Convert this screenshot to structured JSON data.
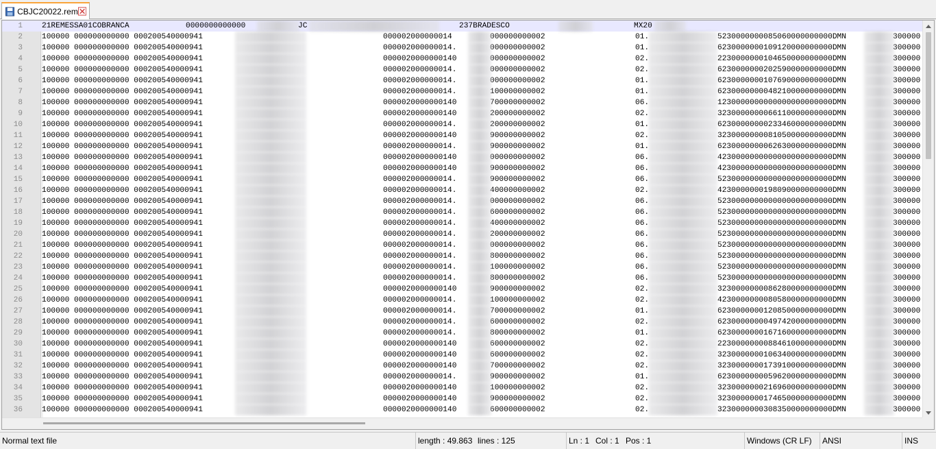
{
  "tab": {
    "filename": "CBJC20022.rem",
    "save_icon": "floppy-disk-icon",
    "close_icon": "close-x-icon"
  },
  "editor": {
    "header_line": {
      "number": "1",
      "part1": "21REMESSA01COBRANCA",
      "part2": "0000000000000",
      "part3": "JC",
      "part4": "237BRADESCO",
      "part5": "MX20"
    },
    "lines": [
      {
        "n": "2",
        "c": "000002000000014",
        "d": "000000000002",
        "e": "01.",
        "f": "5230000000085060000000000DMN",
        "g": "300000"
      },
      {
        "n": "3",
        "c": "000002000000014.",
        "d": "000000000002",
        "e": "01.",
        "f": "6230000000109120000000000DMN",
        "g": "300000"
      },
      {
        "n": "4",
        "c": "0000020000000140",
        "d": "000000000002",
        "e": "02.",
        "f": "2230000000104650000000000DMN",
        "g": "300000"
      },
      {
        "n": "5",
        "c": "000002000000014.",
        "d": "000000000002",
        "e": "02.",
        "f": "6230000000202590000000000DMN",
        "g": "300000"
      },
      {
        "n": "6",
        "c": "000002000000014.",
        "d": "000000000002",
        "e": "01.",
        "f": "6230000000107690000000000DMN",
        "g": "300000"
      },
      {
        "n": "7",
        "c": "000002000000014.",
        "d": "100000000002",
        "e": "01.",
        "f": "6230000000048210000000000DMN",
        "g": "300000"
      },
      {
        "n": "8",
        "c": "0000020000000140",
        "d": "700000000002",
        "e": "06.",
        "f": "1230000000000000000000000DMN",
        "g": "300000"
      },
      {
        "n": "9",
        "c": "0000020000000140",
        "d": "200000000002",
        "e": "02.",
        "f": "3230000000066110000000000DMN",
        "g": "300000"
      },
      {
        "n": "10",
        "c": "000002000000014.",
        "d": "200000000002",
        "e": "01.",
        "f": "6230000000023346000000000DMN",
        "g": "300000"
      },
      {
        "n": "11",
        "c": "0000020000000140",
        "d": "900000000002",
        "e": "02.",
        "f": "3230000000081050000000000DMN",
        "g": "300000"
      },
      {
        "n": "12",
        "c": "000002000000014.",
        "d": "900000000002",
        "e": "01.",
        "f": "6230000000062630000000000DMN",
        "g": "300000"
      },
      {
        "n": "13",
        "c": "0000020000000140",
        "d": "000000000002",
        "e": "06.",
        "f": "4230000000000000000000000DMN",
        "g": "300000"
      },
      {
        "n": "14",
        "c": "0000020000000140",
        "d": "900000000002",
        "e": "06.",
        "f": "4230000000000000000000000DMN",
        "g": "300000"
      },
      {
        "n": "15",
        "c": "000002000000014.",
        "d": "900000000002",
        "e": "06.",
        "f": "5230000000000000000000000DMN",
        "g": "300000"
      },
      {
        "n": "16",
        "c": "000002000000014.",
        "d": "400000000002",
        "e": "02.",
        "f": "4230000000198090000000000DMN",
        "g": "300000"
      },
      {
        "n": "17",
        "c": "000002000000014.",
        "d": "000000000002",
        "e": "06.",
        "f": "5230000000000000000000000DMN",
        "g": "300000"
      },
      {
        "n": "18",
        "c": "000002000000014.",
        "d": "600000000002",
        "e": "06.",
        "f": "5230000000000000000000000DMN",
        "g": "300000"
      },
      {
        "n": "19",
        "c": "000002000000014.",
        "d": "400000000002",
        "e": "06.",
        "f": "5230000000000000000000000DMN",
        "g": "300000"
      },
      {
        "n": "20",
        "c": "000002000000014.",
        "d": "200000000002",
        "e": "06.",
        "f": "5230000000000000000000000DMN",
        "g": "300000"
      },
      {
        "n": "21",
        "c": "000002000000014.",
        "d": "000000000002",
        "e": "06.",
        "f": "5230000000000000000000000DMN",
        "g": "300000"
      },
      {
        "n": "22",
        "c": "000002000000014.",
        "d": "800000000002",
        "e": "06.",
        "f": "5230000000000000000000000DMN",
        "g": "300000"
      },
      {
        "n": "23",
        "c": "000002000000014.",
        "d": "100000000002",
        "e": "06.",
        "f": "5230000000000000000000000DMN",
        "g": "300000"
      },
      {
        "n": "24",
        "c": "000002000000014.",
        "d": "800000000002",
        "e": "06.",
        "f": "5230000000000000000000000DMN",
        "g": "300000"
      },
      {
        "n": "25",
        "c": "0000020000000140",
        "d": "900000000002",
        "e": "02.",
        "f": "3230000000086280000000000DMN",
        "g": "300000"
      },
      {
        "n": "26",
        "c": "000002000000014.",
        "d": "100000000002",
        "e": "02.",
        "f": "4230000000080580000000000DMN",
        "g": "300000"
      },
      {
        "n": "27",
        "c": "000002000000014.",
        "d": "700000000002",
        "e": "01.",
        "f": "6230000000120850000000000DMN",
        "g": "300000"
      },
      {
        "n": "28",
        "c": "000002000000014.",
        "d": "600000000002",
        "e": "02.",
        "f": "6230000000049742000000000DMN",
        "g": "300000"
      },
      {
        "n": "29",
        "c": "000002000000014.",
        "d": "800000000002",
        "e": "01.",
        "f": "6230000000167160000000000DMN",
        "g": "300000"
      },
      {
        "n": "30",
        "c": "0000020000000140",
        "d": "600000000002",
        "e": "02.",
        "f": "2230000000088461000000000DMN",
        "g": "300000"
      },
      {
        "n": "31",
        "c": "0000020000000140",
        "d": "600000000002",
        "e": "02.",
        "f": "3230000000106340000000000DMN",
        "g": "300000"
      },
      {
        "n": "32",
        "c": "0000020000000140",
        "d": "700000000002",
        "e": "02.",
        "f": "3230000000173910000000000DMN",
        "g": "300000"
      },
      {
        "n": "33",
        "c": "000002000000014.",
        "d": "900000000002",
        "e": "01.",
        "f": "6230000000059620000000000DMN",
        "g": "300000"
      },
      {
        "n": "34",
        "c": "0000020000000140",
        "d": "100000000002",
        "e": "02.",
        "f": "3230000000216960000000000DMN",
        "g": "300000"
      },
      {
        "n": "35",
        "c": "0000020000000140",
        "d": "900000000002",
        "e": "02.",
        "f": "3230000000174650000000000DMN",
        "g": "300000"
      },
      {
        "n": "36",
        "c": "0000020000000140",
        "d": "600000000002",
        "e": "02.",
        "f": "3230000000308350000000000DMN",
        "g": "300000"
      }
    ],
    "common_prefix": "100000 000000000000 000200540000941"
  },
  "statusbar": {
    "filetype": "Normal text file",
    "length": "length : 49.863",
    "lines": "lines : 125",
    "ln": "Ln : 1",
    "col": "Col : 1",
    "pos": "Pos : 1",
    "eol": "Windows (CR LF)",
    "encoding": "ANSI",
    "mode": "INS"
  }
}
